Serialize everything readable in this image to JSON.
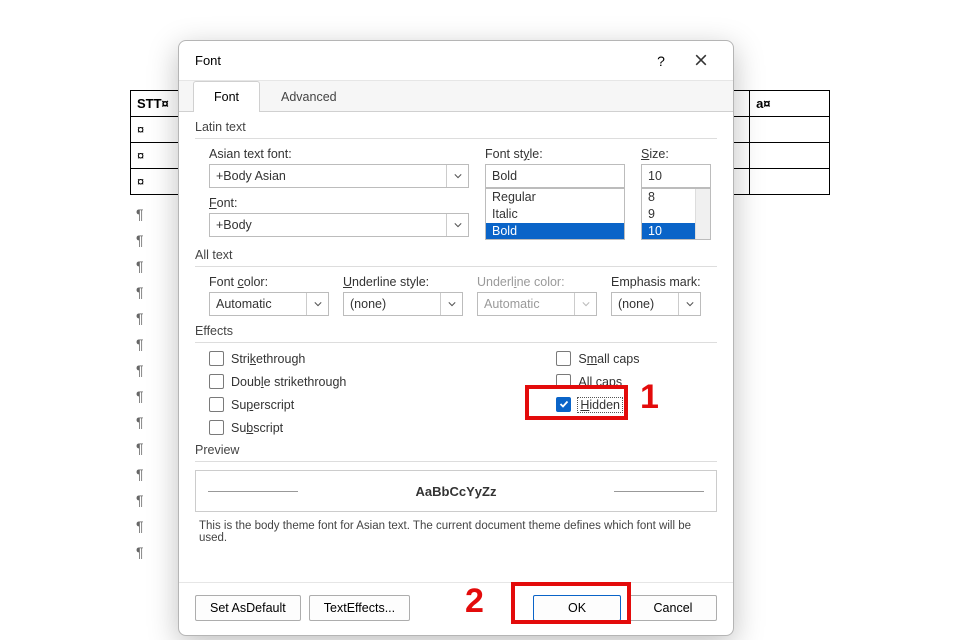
{
  "background": {
    "table_headers": [
      "STT¤",
      "",
      "a¤"
    ],
    "table_rows": [
      [
        "¤",
        "",
        ""
      ],
      [
        "¤",
        "",
        ""
      ],
      [
        "¤",
        "",
        ""
      ]
    ],
    "pilcrow": "¶",
    "pilcrow_count": 14
  },
  "dialog": {
    "title": "Font",
    "help": "?",
    "tabs": {
      "font": "Font",
      "advanced": "Advanced"
    },
    "latin": {
      "legend": "Latin text",
      "asian_font_label": "Asian text font:",
      "asian_font_value": "+Body Asian",
      "font_label": "Font:",
      "font_value": "+Body",
      "style_label": "Font style:",
      "style_value": "Bold",
      "style_options": [
        "Regular",
        "Italic",
        "Bold"
      ],
      "size_label": "Size:",
      "size_value": "10",
      "size_options": [
        "8",
        "9",
        "10"
      ]
    },
    "alltext": {
      "legend": "All text",
      "font_color_label": "Font color:",
      "font_color_value": "Automatic",
      "underline_style_label": "Underline style:",
      "underline_style_value": "(none)",
      "underline_color_label": "Underline color:",
      "underline_color_value": "Automatic",
      "emphasis_label": "Emphasis mark:",
      "emphasis_value": "(none)"
    },
    "effects": {
      "legend": "Effects",
      "strikethrough": "Strikethrough",
      "double_strike": "Double strikethrough",
      "superscript": "Superscript",
      "subscript": "Subscript",
      "small_caps": "Small caps",
      "all_caps": "All caps",
      "hidden": "Hidden"
    },
    "preview": {
      "legend": "Preview",
      "sample": "AaBbCcYyZz",
      "description": "This is the body theme font for Asian text. The current document theme defines which font will be used."
    },
    "buttons": {
      "set_default": "Set As Default",
      "text_effects": "Text Effects...",
      "ok": "OK",
      "cancel": "Cancel"
    }
  },
  "annotations": {
    "one": "1",
    "two": "2"
  }
}
